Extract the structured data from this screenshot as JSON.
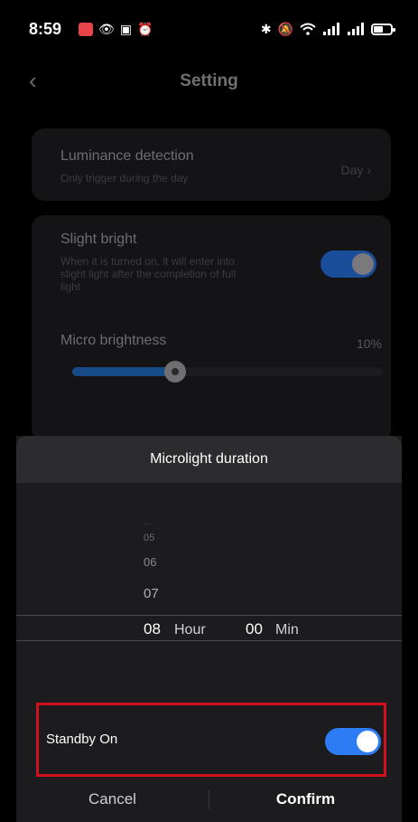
{
  "status_bar": {
    "time": "8:59",
    "left_icons": [
      "app-notification-icon",
      "eye-icon",
      "nfc-icon",
      "alarm-icon"
    ],
    "right_icons": [
      "bluetooth-icon",
      "mute-icon",
      "wifi-icon",
      "signal-icon",
      "signal-icon",
      "battery-icon"
    ]
  },
  "header": {
    "title": "Setting"
  },
  "luminance": {
    "title": "Luminance detection",
    "subtitle": "Only trigger during the day",
    "value": "Day"
  },
  "slight_bright": {
    "title": "Slight bright",
    "description_lines": [
      "When it is turned on, it will enter into",
      "slight light after the completion of full",
      "light"
    ],
    "enabled": true
  },
  "micro_brightness": {
    "label": "Micro brightness",
    "value_text": "10%",
    "value": 0.1
  },
  "sheet": {
    "title": "Microlight duration",
    "hour_options_visible": [
      "…",
      "05",
      "06",
      "07"
    ],
    "selected_hour": "08",
    "hour_unit": "Hour",
    "selected_min": "00",
    "min_unit": "Min",
    "standby": {
      "label": "Standby On",
      "enabled": true
    },
    "cancel_label": "Cancel",
    "confirm_label": "Confirm"
  },
  "colors": {
    "accent": "#2d7cf6",
    "highlight_border": "#d0101e"
  }
}
